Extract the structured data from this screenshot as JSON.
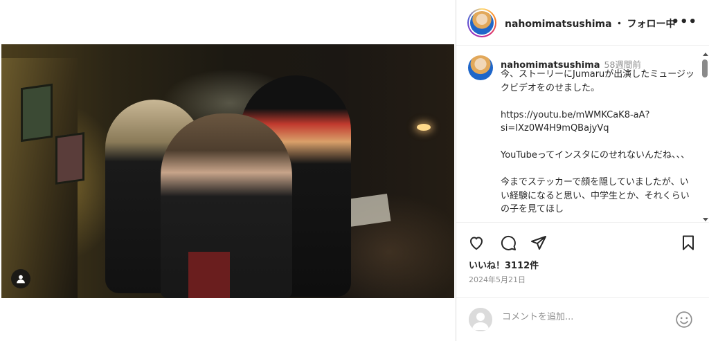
{
  "post": {
    "photo_alt": "",
    "tag_icon": "user-tag-icon"
  },
  "header": {
    "username": "nahomimatsushima",
    "separator": "・",
    "follow_status": "フォロー中",
    "more_icon": "more-horizontal-icon",
    "more_label": "•••"
  },
  "caption": {
    "username": "nahomimatsushima",
    "time": "58週間前",
    "paragraphs": [
      "今、ストーリーにJumaruが出演したミュージックビデオをのせました。",
      "https://youtu.be/mWMKCaK8-aA?si=IXz0W4H9mQBajyVq",
      "YouTubeってインスタにのせれないんだね、、、",
      "今までステッカーで顔を隠していましたが、いい経験になると思い、中学生とか、それくらいの子を見てほし"
    ]
  },
  "actions": {
    "like_icon": "heart-icon",
    "comment_icon": "comment-icon",
    "share_icon": "share-icon",
    "save_icon": "bookmark-icon"
  },
  "likes": "いいね！3112件",
  "date": "2024年5月21日",
  "comment": {
    "placeholder": "コメントを追加...",
    "emoji_icon": "emoji-icon"
  }
}
